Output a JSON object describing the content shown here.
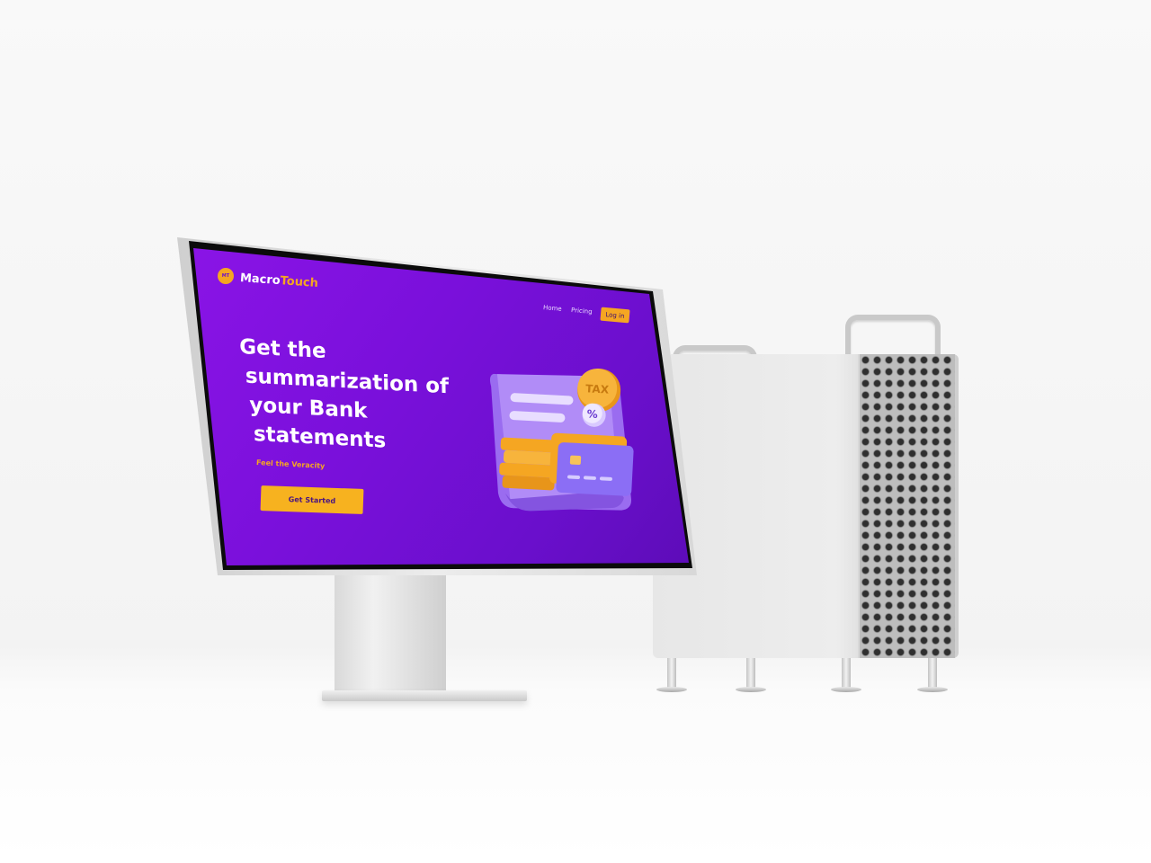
{
  "site": {
    "logo_text": "MT",
    "brand_part1": "Macro",
    "brand_part2": "Touch"
  },
  "nav": {
    "home": "Home",
    "pricing": "Pricing",
    "login": "Log in"
  },
  "hero": {
    "title_lines": [
      "Get the",
      "summarization of",
      "your Bank",
      "statements"
    ],
    "tagline": "Feel the Veracity",
    "cta": "Get  Started"
  },
  "illustration": {
    "coin_text": "TAX",
    "badge_text": "%"
  },
  "colors": {
    "background_purple": "#7a10db",
    "accent_orange": "#f5a622",
    "text_white": "#ffffff"
  },
  "icons": [
    "logo-badge-icon",
    "tax-coin-icon",
    "percent-badge-icon",
    "credit-card-icon",
    "receipt-icon"
  ]
}
